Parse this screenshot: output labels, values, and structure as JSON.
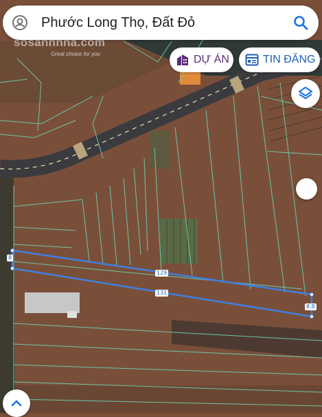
{
  "search": {
    "query": "Phước Long Thọ, Đất Đỏ"
  },
  "watermark": {
    "brand": "sosanhnha.com",
    "tagline": "Great choice for you"
  },
  "chips": {
    "du_an": {
      "label": "DỰ ÁN",
      "icon": "building-icon"
    },
    "tin_dang": {
      "label": "TIN ĐĂNG",
      "icon": "listing-icon"
    }
  },
  "controls": {
    "layers": {
      "icon": "layers-icon"
    },
    "scroll_handle": {
      "icon": "handle-dot"
    },
    "expand": {
      "icon": "chevron-up-icon"
    }
  },
  "measurements": {
    "left_edge": "8",
    "top_edge": "129",
    "bottom_edge": "131",
    "right_edge": "8.8"
  },
  "colors": {
    "land": "#7a4f3a",
    "road": "#3b3b3f",
    "parcel_lines": "#6ed3b5",
    "plot_outline": "#3f7fe0",
    "chip_du_an": "#5b2d7a",
    "chip_tin_dang": "#1f5fb0",
    "search_icon": "#1a73e8"
  }
}
